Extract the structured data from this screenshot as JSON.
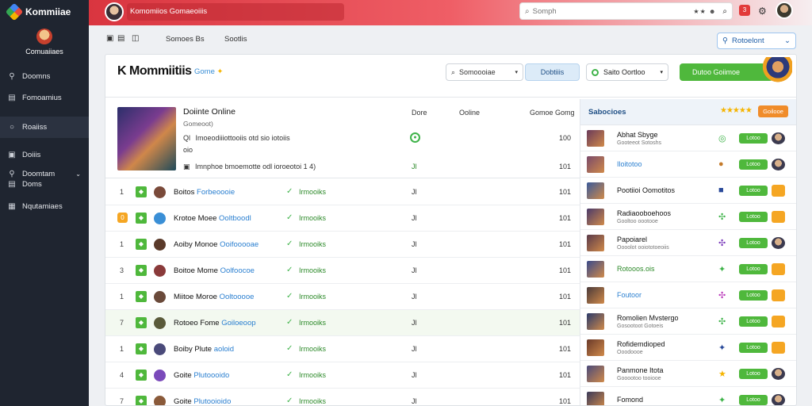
{
  "app": {
    "name": "Kommiiae",
    "profile_name": "Comuaiiaes"
  },
  "sidebar": {
    "items": [
      {
        "label": "Doomns",
        "icon": "pin-icon",
        "active": false
      },
      {
        "label": "Fomoamius",
        "icon": "document-icon",
        "active": false
      },
      {
        "label": "Roaiiss",
        "icon": "circle-icon",
        "active": true
      },
      {
        "label": "Doiiis",
        "icon": "box-icon",
        "active": false
      },
      {
        "label": "Doomtam",
        "label2": "Doms",
        "icon": "pin-icon",
        "active": false
      },
      {
        "label": "Nqutamiaes",
        "icon": "grid-icon",
        "active": false
      }
    ]
  },
  "topbar": {
    "title": "Komomiios Gomaeoiiis",
    "search_placeholder": "Somph",
    "search_extra": "★★ ☻",
    "notif_count": "3"
  },
  "subbar": {
    "link1": "Somoes Bs",
    "link2": "Sootlis",
    "select_label": "Rotoelont"
  },
  "card": {
    "title": "K Mommiitiis",
    "subtitle": "Gome",
    "filter_placeholder": "Somoooiae",
    "filter_button": "Dobtiiis",
    "status_label": "Saito Oortloo",
    "primary_button": "Dutoo Goiimoe"
  },
  "feature": {
    "title": "Doiinte Online",
    "subtitle": "Gomeoot)",
    "line1": "Imoeodiiiottooiis otd sio iotoiis",
    "line1_icon": "Ql",
    "line2": "oio",
    "line3": "Imnphoe bmoemotte odl ioroeotoi 1  4)",
    "col_done": "Dore",
    "col_online": "Ooline",
    "col_games": "Gomoe Gomg",
    "val_done_2": "Jl",
    "val_games_1": "100",
    "val_games_2": "101"
  },
  "rows": [
    {
      "num": "1",
      "num_style": "plain",
      "name": "Boitos",
      "link": "Forbeoooie",
      "status": "Irmooiks",
      "mid": "Jl",
      "val": "101",
      "avatar": "#7a4a3a",
      "tint": false
    },
    {
      "num": "0",
      "num_style": "orange",
      "name": "Krotoe Moee",
      "link": "Ooltboodl",
      "status": "Irmooiks",
      "mid": "Jl",
      "val": "101",
      "avatar": "#3a8fd6",
      "tint": false
    },
    {
      "num": "1",
      "num_style": "plain",
      "name": "Aoiby Monoe",
      "link": "Ooifooooae",
      "status": "Irmooiks",
      "mid": "Jl",
      "val": "101",
      "avatar": "#5a3a2a",
      "tint": false
    },
    {
      "num": "3",
      "num_style": "plain",
      "name": "Boitoe Mome",
      "link": "Oolfoocoe",
      "status": "Irmooiks",
      "mid": "Jl",
      "val": "101",
      "avatar": "#8a3a3a",
      "tint": false
    },
    {
      "num": "1",
      "num_style": "plain",
      "name": "Miitoe Moroe",
      "link": "Ooltooooe",
      "status": "Irmooiks",
      "mid": "Jl",
      "val": "101",
      "avatar": "#6a4a3a",
      "tint": false
    },
    {
      "num": "7",
      "num_style": "plain",
      "name": "Rotoeo Fome",
      "link": "Goiloeoop",
      "status": "Irmooiks",
      "mid": "Jl",
      "val": "101",
      "avatar": "#5a5a3a",
      "tint": true
    },
    {
      "num": "1",
      "num_style": "plain",
      "name": "Boiby Plute",
      "link": "aoloid",
      "status": "Irmooiks",
      "mid": "Jl",
      "val": "101",
      "avatar": "#4a4a7a",
      "tint": false
    },
    {
      "num": "4",
      "num_style": "plain",
      "name": "Goite",
      "link": "Plutoooido",
      "status": "Irmooiks",
      "mid": "Jl",
      "val": "101",
      "avatar": "#7a4aba",
      "tint": false
    },
    {
      "num": "7",
      "num_style": "plain",
      "name": "Goite",
      "link": "Plutooioido",
      "status": "Irmooiks",
      "mid": "Jl",
      "val": "101",
      "avatar": "#8a5a3a",
      "tint": false
    }
  ],
  "right_panel": {
    "header_label": "Sabocioes",
    "header_stars": "★★★★★",
    "header_button": "Goilooe",
    "items": [
      {
        "title": "Abhat Sbyge",
        "subtitle": "Gooteeot Sotoshs",
        "color": "default",
        "mini": "◎",
        "mini_color": "#3fb34a",
        "button": "Lotoo",
        "end": "avatar",
        "thumb": "#6a3a5a"
      },
      {
        "title": "Iloitotoo",
        "subtitle": "",
        "color": "blue",
        "mini": "●",
        "mini_color": "#c47a2a",
        "button": "Lotoo",
        "end": "avatar",
        "thumb": "#7a4a6a"
      },
      {
        "title": "Pootiioi Oomotitos",
        "subtitle": "",
        "color": "default",
        "mini": "■",
        "mini_color": "#2a4a9a",
        "button": "Lotoo",
        "end": "orange",
        "thumb": "#3a5a9a"
      },
      {
        "title": "Radiaooboehoos",
        "subtitle": "Gooltoo oootooe",
        "color": "default",
        "mini": "✣",
        "mini_color": "#3fb34a",
        "button": "Lotoo",
        "end": "orange",
        "thumb": "#4a3a6a"
      },
      {
        "title": "Papoiarel",
        "subtitle": "Oooolot ooiototoeoiis",
        "color": "default",
        "mini": "✣",
        "mini_color": "#7a3aba",
        "button": "Lotoo",
        "end": "avatar",
        "thumb": "#5a3a4a"
      },
      {
        "title": "Rotooos.ois",
        "subtitle": "",
        "color": "green",
        "mini": "✦",
        "mini_color": "#3fb34a",
        "button": "Lotoo",
        "end": "orange",
        "thumb": "#3a4a8a"
      },
      {
        "title": "Foutoor",
        "subtitle": "",
        "color": "blue",
        "mini": "✣",
        "mini_color": "#ba3aba",
        "button": "Lotoo",
        "end": "orange",
        "thumb": "#4a3a3a"
      },
      {
        "title": "Romolien Mvstergo",
        "subtitle": "Gosootoot Gotoeis",
        "color": "default",
        "mini": "✣",
        "mini_color": "#3fb34a",
        "button": "Lotoo",
        "end": "orange",
        "thumb": "#2a3a6a"
      },
      {
        "title": "Rofidemdioped",
        "subtitle": "Ooodoooe",
        "color": "default",
        "mini": "✦",
        "mini_color": "#2a4a9a",
        "button": "Lotoo",
        "end": "orange",
        "thumb": "#6a3a2a"
      },
      {
        "title": "Panmone Itota",
        "subtitle": "Gooootoo tooiooe",
        "color": "default",
        "mini": "★",
        "mini_color": "#f5b400",
        "button": "Lotoo",
        "end": "avatar",
        "thumb": "#4a4a7a"
      },
      {
        "title": "Fomond",
        "subtitle": "",
        "color": "default",
        "mini": "✦",
        "mini_color": "#3fb34a",
        "button": "Lotoo",
        "end": "avatar",
        "thumb": "#3a3a5a"
      }
    ]
  }
}
